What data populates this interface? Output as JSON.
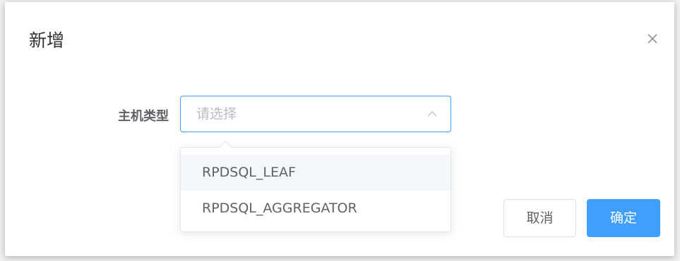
{
  "dialog": {
    "title": "新增",
    "close_icon": "close-icon"
  },
  "form": {
    "host_type_label": "主机类型",
    "host_type_select": {
      "placeholder": "请选择",
      "arrow_icon": "chevron-up-icon",
      "options": [
        {
          "label": "RPDSQL_LEAF",
          "hovered": true
        },
        {
          "label": "RPDSQL_AGGREGATOR",
          "hovered": false
        }
      ]
    }
  },
  "footer": {
    "cancel_label": "取消",
    "confirm_label": "确定"
  },
  "colors": {
    "primary": "#409eff",
    "text_regular": "#606266",
    "placeholder": "#b9bcc2",
    "border": "#dcdfe6",
    "hover_bg": "#f5f7fa"
  }
}
